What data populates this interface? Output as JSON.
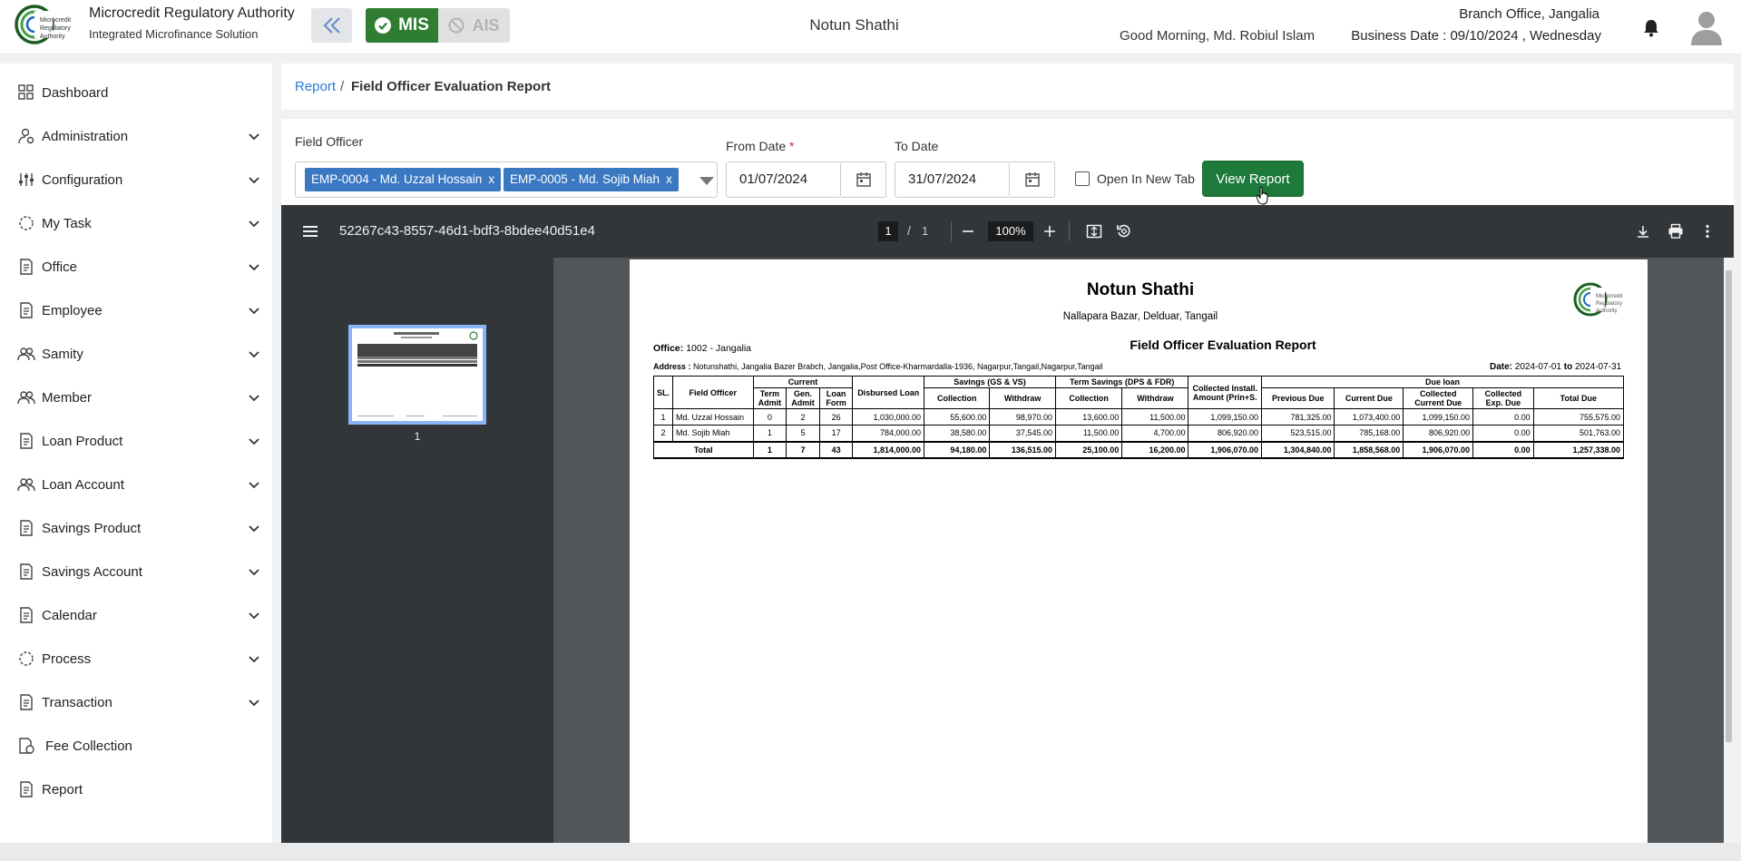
{
  "header": {
    "brand_title": "Microcredit Regulatory Authority",
    "brand_subtitle": "Integrated Microfinance Solution",
    "logo_text": "Microcredit Regulatory Authority",
    "mode_mis": "MIS",
    "mode_ais": "AIS",
    "org_name": "Notun Shathi",
    "greeting": "Good Morning, Md. Robiul Islam",
    "branch": "Branch Office, Jangalia",
    "business_date": "Business Date : 09/10/2024 , Wednesday",
    "accent_color": "#2e7d32"
  },
  "sidebar": {
    "items": [
      {
        "label": "Dashboard",
        "icon": "grid-icon"
      },
      {
        "label": "Administration",
        "icon": "admin-icon"
      },
      {
        "label": "Configuration",
        "icon": "sliders-icon"
      },
      {
        "label": "My Task",
        "icon": "task-icon"
      },
      {
        "label": "Office",
        "icon": "document-icon"
      },
      {
        "label": "Employee",
        "icon": "document-icon"
      },
      {
        "label": "Samity",
        "icon": "group-icon"
      },
      {
        "label": "Member",
        "icon": "group-icon"
      },
      {
        "label": "Loan Product",
        "icon": "document-icon"
      },
      {
        "label": "Loan Account",
        "icon": "group-icon"
      },
      {
        "label": "Savings Product",
        "icon": "document-icon"
      },
      {
        "label": "Savings Account",
        "icon": "document-icon"
      },
      {
        "label": "Calendar",
        "icon": "document-icon"
      },
      {
        "label": "Process",
        "icon": "task-icon"
      },
      {
        "label": "Transaction",
        "icon": "document-icon"
      },
      {
        "label": "Fee Collection",
        "icon": "fee-icon"
      },
      {
        "label": "Report",
        "icon": "document-icon"
      }
    ]
  },
  "breadcrumb": {
    "root": "Report",
    "separator": "/",
    "current": "Field Officer Evaluation Report"
  },
  "filters": {
    "field_officer_label": "Field Officer",
    "selected_officers": [
      "EMP-0004 - Md. Uzzal Hossain",
      "EMP-0005 - Md. Sojib Miah"
    ],
    "chip_remove": "x",
    "from_date_label": "From Date",
    "required_mark": "*",
    "from_date": "01/07/2024",
    "to_date_label": "To Date",
    "to_date": "31/07/2024",
    "open_new_tab_label": "Open In New Tab",
    "open_new_tab_checked": false,
    "view_report_label": "View Report"
  },
  "viewer": {
    "file_title": "52267c43-8557-46d1-bdf3-8bdee40d51e4",
    "current_page": "1",
    "page_separator": "/",
    "total_pages": "1",
    "zoom": "100%",
    "thumb_label": "1"
  },
  "report": {
    "org": "Notun Shathi",
    "org_address": "Nallapara Bazar, Delduar, Tangail",
    "logo_text": "Microcredit Regulatory Authority",
    "office_label": "Office:",
    "office": "1002 - Jangalia",
    "title": "Field Officer Evaluation Report",
    "address_label": "Address :",
    "address": "Notunshathi, Jangalia Bazer Brabch, Jangalia,Post Office-Kharmardalla-1936, Nagarpur,Tangail,Nagarpur,Tangail",
    "date_label": "Date:",
    "date_from": "2024-07-01",
    "date_to_word": "to",
    "date_to": "2024-07-31",
    "headers": {
      "sl": "SL.",
      "field_officer": "Field Officer",
      "current": "Current",
      "term_admit": "Term Admit",
      "gen_admit": "Gen. Admit",
      "loan_form": "Loan Form",
      "disbursed_loan": "Disbursed Loan",
      "savings": "Savings (GS & VS)",
      "collection": "Collection",
      "withdraw": "Withdraw",
      "term_savings": "Term Savings (DPS & FDR)",
      "collected_install": "Collected Install. Amount (Prin+S.",
      "due_loan": "Due loan",
      "previous_due": "Previous Due",
      "current_due": "Current Due",
      "collected_current_due": "Collected Current Due",
      "collected_exp_due": "Collected Exp. Due",
      "total_due": "Total Due"
    },
    "rows": [
      {
        "sl": "1",
        "officer": "Md. Uzzal Hossain",
        "term_admit": "0",
        "gen_admit": "2",
        "loan_form": "26",
        "disbursed": "1,030,000.00",
        "sav_coll": "55,600.00",
        "sav_wd": "98,970.00",
        "term_coll": "13,600.00",
        "term_wd": "11,500.00",
        "coll_install": "1,099,150.00",
        "prev_due": "781,325.00",
        "curr_due": "1,073,400.00",
        "coll_curr_due": "1,099,150.00",
        "coll_exp_due": "0.00",
        "total_due": "755,575.00"
      },
      {
        "sl": "2",
        "officer": "Md. Sojib Miah",
        "term_admit": "1",
        "gen_admit": "5",
        "loan_form": "17",
        "disbursed": "784,000.00",
        "sav_coll": "38,580.00",
        "sav_wd": "37,545.00",
        "term_coll": "11,500.00",
        "term_wd": "4,700.00",
        "coll_install": "806,920.00",
        "prev_due": "523,515.00",
        "curr_due": "785,168.00",
        "coll_curr_due": "806,920.00",
        "coll_exp_due": "0.00",
        "total_due": "501,763.00"
      }
    ],
    "total": {
      "label": "Total",
      "term_admit": "1",
      "gen_admit": "7",
      "loan_form": "43",
      "disbursed": "1,814,000.00",
      "sav_coll": "94,180.00",
      "sav_wd": "136,515.00",
      "term_coll": "25,100.00",
      "term_wd": "16,200.00",
      "coll_install": "1,906,070.00",
      "prev_due": "1,304,840.00",
      "curr_due": "1,858,568.00",
      "coll_curr_due": "1,906,070.00",
      "coll_exp_due": "0.00",
      "total_due": "1,257,338.00"
    }
  }
}
